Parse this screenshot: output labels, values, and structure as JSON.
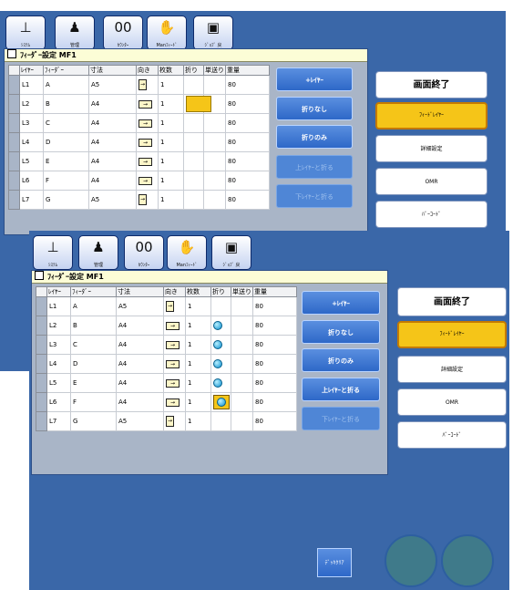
{
  "toolbar": [
    {
      "icon": "⊥",
      "label": "ｼｽﾃﾑ",
      "icon_name": "system-icon"
    },
    {
      "icon": "♟",
      "label": "管理",
      "icon_name": "admin-icon"
    },
    {
      "icon": "00",
      "label": "ｶｳﾝﾀｰ",
      "icon_name": "counter-icon"
    },
    {
      "icon": "✋",
      "label": "Manﾌｨｰﾄﾞ",
      "icon_name": "hand-icon"
    },
    {
      "icon": "▣",
      "label": "ｼﾞｮﾌﾞ 戻",
      "icon_name": "job-icon"
    }
  ],
  "back": {
    "title": "ﾌｨｰﾀﾞｰ設定 MF1",
    "headers": [
      "ﾚｲﾔｰ",
      "ﾌｨｰﾀﾞｰ",
      "寸法",
      "向き",
      "枚数",
      "折り",
      "単送り",
      "重量"
    ],
    "rows": [
      {
        "layer": "L1",
        "feeder": "A",
        "size": "A5",
        "orient": "port",
        "count": "1",
        "fold": "",
        "weight": "80"
      },
      {
        "layer": "L2",
        "feeder": "B",
        "size": "A4",
        "orient": "land",
        "count": "1",
        "fold": "yellow",
        "weight": "80"
      },
      {
        "layer": "L3",
        "feeder": "C",
        "size": "A4",
        "orient": "land",
        "count": "1",
        "fold": "",
        "weight": "80"
      },
      {
        "layer": "L4",
        "feeder": "D",
        "size": "A4",
        "orient": "land",
        "count": "1",
        "fold": "",
        "weight": "80"
      },
      {
        "layer": "L5",
        "feeder": "E",
        "size": "A4",
        "orient": "land",
        "count": "1",
        "fold": "",
        "weight": "80"
      },
      {
        "layer": "L6",
        "feeder": "F",
        "size": "A4",
        "orient": "land",
        "count": "1",
        "fold": "",
        "weight": "80"
      },
      {
        "layer": "L7",
        "feeder": "G",
        "size": "A5",
        "orient": "port",
        "count": "1",
        "fold": "",
        "weight": "80"
      }
    ],
    "buttons": [
      "+ﾚｲﾔｰ",
      "折りなし",
      "折りのみ",
      "上ﾚｲﾔｰと折る",
      "下ﾚｲﾔｰと折る"
    ],
    "right": [
      "画面終了",
      "ﾌｨｰﾄﾞﾚｲﾔｰ",
      "詳細設定",
      "OMR",
      "ﾊﾞｰｺｰﾄﾞ"
    ]
  },
  "front": {
    "title": "ﾌｨｰﾀﾞｰ設定 MF1",
    "headers": [
      "ﾚｲﾔｰ",
      "ﾌｨｰﾀﾞｰ",
      "寸法",
      "向き",
      "枚数",
      "折り",
      "単送り",
      "重量"
    ],
    "rows": [
      {
        "layer": "L1",
        "feeder": "A",
        "size": "A5",
        "orient": "port",
        "count": "1",
        "fold": "",
        "weight": "80"
      },
      {
        "layer": "L2",
        "feeder": "B",
        "size": "A4",
        "orient": "land",
        "count": "1",
        "fold": "dot",
        "weight": "80"
      },
      {
        "layer": "L3",
        "feeder": "C",
        "size": "A4",
        "orient": "land",
        "count": "1",
        "fold": "dot",
        "weight": "80"
      },
      {
        "layer": "L4",
        "feeder": "D",
        "size": "A4",
        "orient": "land",
        "count": "1",
        "fold": "dot",
        "weight": "80"
      },
      {
        "layer": "L5",
        "feeder": "E",
        "size": "A4",
        "orient": "land",
        "count": "1",
        "fold": "dot",
        "weight": "80"
      },
      {
        "layer": "L6",
        "feeder": "F",
        "size": "A4",
        "orient": "land",
        "count": "1",
        "fold": "dotbox",
        "weight": "80"
      },
      {
        "layer": "L7",
        "feeder": "G",
        "size": "A5",
        "orient": "port",
        "count": "1",
        "fold": "",
        "weight": "80"
      }
    ],
    "buttons": [
      "+ﾚｲﾔｰ",
      "折りなし",
      "折りのみ",
      "上ﾚｲﾔｰと折る",
      "下ﾚｲﾔｰと折る"
    ],
    "right": [
      "画面終了",
      "ﾌｨｰﾄﾞﾚｲﾔｰ",
      "詳細設定",
      "OMR",
      "ﾊﾞｰｺｰﾄﾞ"
    ],
    "clear_label": "ﾃﾞｯｷｸﾘｱ"
  },
  "colors": {
    "frame": "#3a67a8",
    "title_bar": "#fcfdd6",
    "selected": "#f5c518",
    "button": "#2e68c8"
  }
}
